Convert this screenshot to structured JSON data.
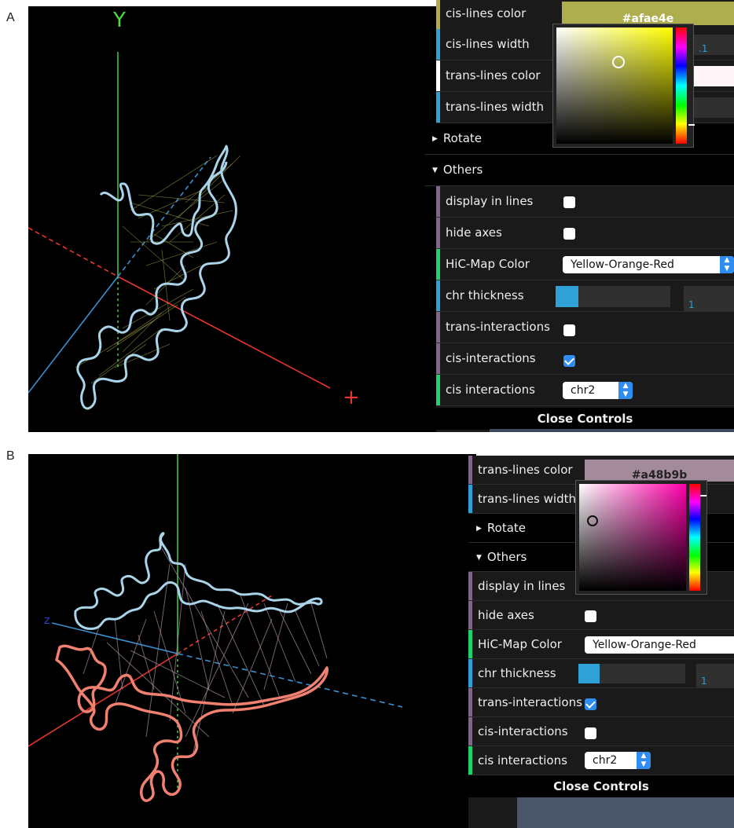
{
  "panels": {
    "a": {
      "letter": "A",
      "axis_y_label": "Y",
      "controls": {
        "cis_lines_color_label": "cis-lines color",
        "cis_lines_color_value": "#afae4e",
        "cis_lines_width_label": "cis-lines width",
        "cis_lines_width_value": ".1",
        "trans_lines_color_label": "trans-lines color",
        "trans_lines_width_label": "trans-lines width",
        "rotate_label": "Rotate",
        "others_label": "Others",
        "display_in_lines_label": "display in lines",
        "display_in_lines_checked": false,
        "hide_axes_label": "hide axes",
        "hide_axes_checked": false,
        "hic_map_color_label": "HiC-Map Color",
        "hic_map_color_value": "Yellow-Orange-Red",
        "chr_thickness_label": "chr thickness",
        "chr_thickness_value": "1",
        "chr_thickness_fraction": 0.2,
        "trans_interactions_label": "trans-interactions",
        "trans_interactions_checked": false,
        "cis_interactions_label": "cis-interactions",
        "cis_interactions_checked": true,
        "cis_interactions_select_label": "cis interactions",
        "cis_interactions_select_value": "chr2",
        "close_controls": "Close Controls"
      },
      "picker_color": "#ffff00"
    },
    "b": {
      "letter": "B",
      "axis_z_label": "z",
      "controls": {
        "trans_lines_color_label": "trans-lines color",
        "trans_lines_color_value": "#a48b9b",
        "trans_lines_width_label": "trans-lines width",
        "rotate_label": "Rotate",
        "others_label": "Others",
        "display_in_lines_label": "display in lines",
        "display_in_lines_checked": false,
        "hide_axes_label": "hide axes",
        "hide_axes_checked": false,
        "hic_map_color_label": "HiC-Map Color",
        "hic_map_color_value": "Yellow-Orange-Red",
        "chr_thickness_label": "chr thickness",
        "chr_thickness_value": "1",
        "chr_thickness_fraction": 0.2,
        "trans_interactions_label": "trans-interactions",
        "trans_interactions_checked": true,
        "cis_interactions_label": "cis-interactions",
        "cis_interactions_checked": false,
        "cis_interactions_select_label": "cis interactions",
        "cis_interactions_select_value": "chr2",
        "close_controls": "Close Controls"
      },
      "picker_color": "#ff00aa"
    }
  },
  "colors": {
    "stripe_color": "#b5a94a",
    "stripe_number": "#2fa1d6",
    "stripe_bool": "#806787",
    "stripe_option": "#1ed36f",
    "stripe_text_white": "#ffffff",
    "chromosome_a": "#a9d4ea",
    "chromosome_b1": "#a9d4ea",
    "chromosome_b2": "#f08070",
    "cis_lines": "#afae4e",
    "trans_lines": "#a48b9b",
    "axis_x": "#e8362e",
    "axis_y": "#4ed84e",
    "axis_z": "#3a8fd0"
  }
}
